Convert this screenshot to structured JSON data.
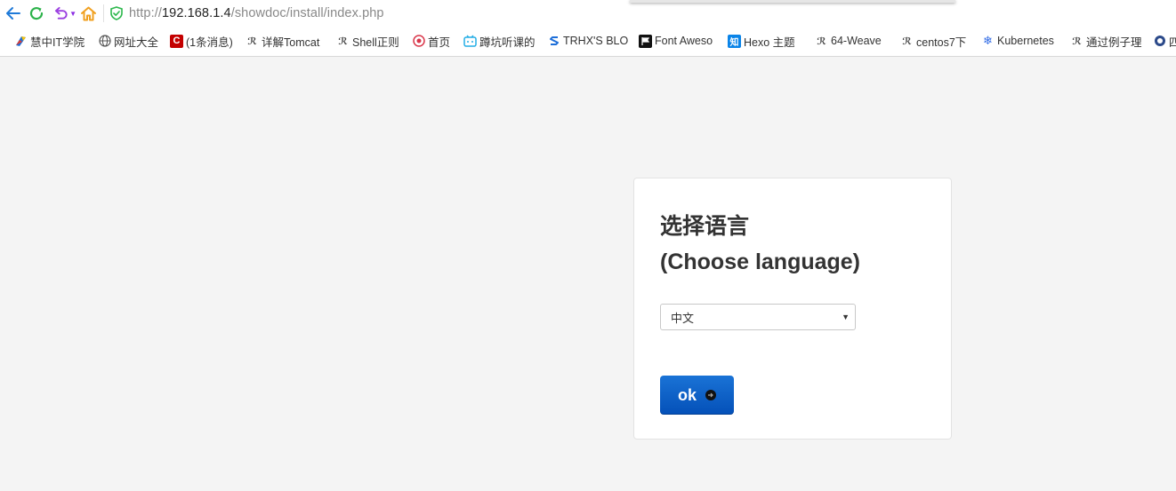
{
  "browser": {
    "url_scheme": "http://",
    "url_host": "192.168.1.4",
    "url_path": "/showdoc/install/index.php"
  },
  "bookmarks": [
    {
      "label": "慧中IT学院",
      "icon": "hzit-logo-icon",
      "color": "#1e6fd9"
    },
    {
      "label": "网址大全",
      "icon": "globe-icon",
      "color": "#555555"
    },
    {
      "label": "(1条消息)",
      "icon": "csdn-logo-icon",
      "color": "#c40000"
    },
    {
      "label": "详解Tomcat",
      "icon": "scribble-icon",
      "color": "#444444"
    },
    {
      "label": "Shell正则",
      "icon": "scribble-icon",
      "color": "#444444"
    },
    {
      "label": "首页",
      "icon": "circle-logo-icon",
      "color": "#d9364a"
    },
    {
      "label": "蹲坑听课的",
      "icon": "bilibili-icon",
      "color": "#23ade5"
    },
    {
      "label": "TRHX'S BLO",
      "icon": "s-logo-icon",
      "color": "#1e6fd9"
    },
    {
      "label": "Font Aweso",
      "icon": "flag-icon",
      "color": "#111111"
    },
    {
      "label": "Hexo 主题",
      "icon": "zhihu-icon",
      "color": "#0a84e8"
    },
    {
      "label": "64-Weave",
      "icon": "scribble-icon",
      "color": "#444444"
    },
    {
      "label": "centos7下",
      "icon": "scribble-icon",
      "color": "#444444"
    },
    {
      "label": "Kubernetes",
      "icon": "snowflake-icon",
      "color": "#326ce5"
    },
    {
      "label": "通过例子理",
      "icon": "scribble-icon",
      "color": "#444444"
    },
    {
      "label": "四",
      "icon": "badge-icon",
      "color": "#2c4a8a"
    }
  ],
  "install": {
    "title_cn": "选择语言",
    "title_en": "(Choose language)",
    "language_selected": "中文",
    "ok_label": "ok"
  },
  "colors": {
    "page_bg": "#f4f4f4",
    "button_blue": "#0a5fcf",
    "shield_green": "#2db84d"
  }
}
